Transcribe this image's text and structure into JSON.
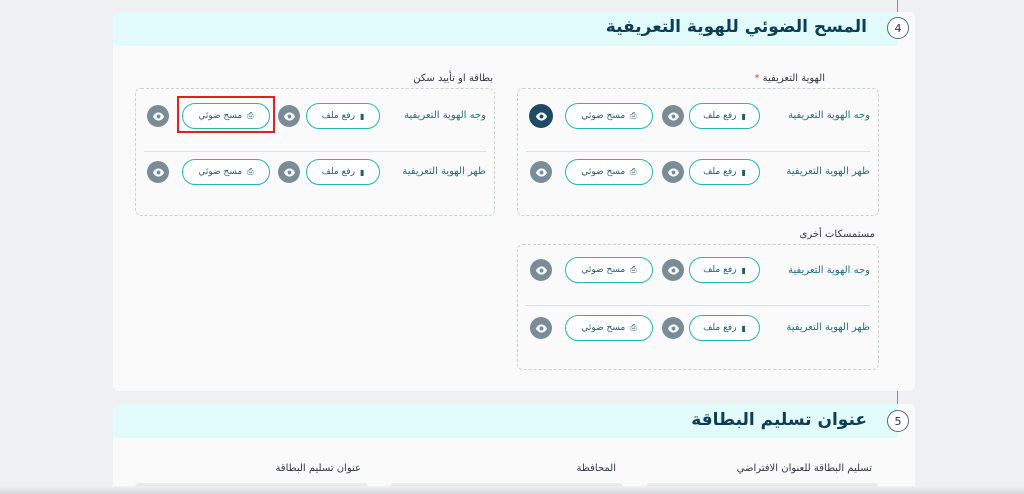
{
  "section4": {
    "number": "4",
    "title": "المسح الضوئي للهوية التعريفية",
    "identity": {
      "label": "الهوية التعريفية",
      "required_mark": "*",
      "rows": [
        {
          "label": "وجه الهوية التعريفية",
          "upload": "رفع ملف",
          "scan": "مسح ضوئي"
        },
        {
          "label": "ظهر الهوية التعريفية",
          "upload": "رفع ملف",
          "scan": "مسح ضوئي"
        }
      ]
    },
    "residence": {
      "label": "بطاقة او تأييد سكن",
      "rows": [
        {
          "label": "وجه الهوية التعريفية",
          "upload": "رفع ملف",
          "scan": "مسح ضوئي"
        },
        {
          "label": "ظهر الهوية التعريفية",
          "upload": "رفع ملف",
          "scan": "مسح ضوئي"
        }
      ]
    },
    "other": {
      "label": "مستمسكات أخرى",
      "rows": [
        {
          "label": "وجه الهوية التعريفية",
          "upload": "رفع ملف",
          "scan": "مسح ضوئي"
        },
        {
          "label": "ظهر الهوية التعريفية",
          "upload": "رفع ملف",
          "scan": "مسح ضوئي"
        }
      ]
    }
  },
  "section5": {
    "number": "5",
    "title": "عنوان تسليم البطاقة",
    "fields": {
      "default_address": "تسليم البطاقة للعنوان الافتراضي",
      "governorate": "المحافظة",
      "delivery_address": "عنوان تسليم البطاقة"
    }
  },
  "colors": {
    "accent": "#2bb5ad",
    "header_bg": "#e1fafa",
    "title": "#0e3d57",
    "highlight": "#e0211d"
  }
}
